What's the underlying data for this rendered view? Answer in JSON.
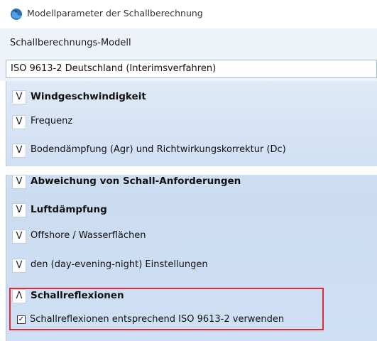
{
  "window": {
    "title": "Modellparameter der Schallberechnung",
    "icon": "globe-app-icon"
  },
  "model": {
    "label": "Schallberechnungs-Modell",
    "selected": "ISO 9613-2 Deutschland (Interimsverfahren)"
  },
  "sections": [
    {
      "label": "Windgeschwindigkeit",
      "bold": true,
      "expanded": false,
      "chevron": "V"
    },
    {
      "label": "Frequenz",
      "bold": false,
      "expanded": false,
      "chevron": "V"
    },
    {
      "label": "Bodendämpfung (Agr) und Richtwirkungskorrektur (Dc)",
      "bold": false,
      "expanded": false,
      "chevron": "V"
    },
    {
      "label": "Abweichung von Schall-Anforderungen",
      "bold": true,
      "expanded": false,
      "chevron": "V"
    },
    {
      "label": "Luftdämpfung",
      "bold": true,
      "expanded": false,
      "chevron": "V"
    },
    {
      "label": "Offshore / Wasserflächen",
      "bold": false,
      "expanded": false,
      "chevron": "V"
    },
    {
      "label": "den (day-evening-night) Einstellungen",
      "bold": false,
      "expanded": false,
      "chevron": "V"
    },
    {
      "label": "Schallreflexionen",
      "bold": true,
      "expanded": true,
      "chevron": "Λ"
    }
  ],
  "reflexion_option": {
    "checked": true,
    "check_glyph": "✓",
    "label": "Schallreflexionen entsprechend ISO 9613-2 verwenden"
  },
  "colors": {
    "highlight": "#e0293a",
    "panel": "#cbdcf1"
  }
}
